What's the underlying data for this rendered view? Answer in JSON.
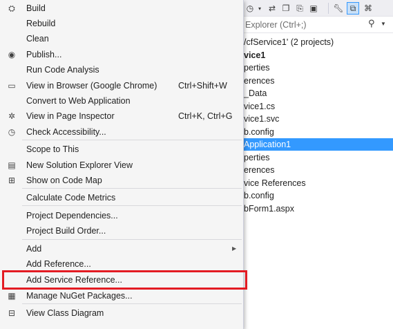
{
  "menu": {
    "items": [
      {
        "label": "Build",
        "icon": "build-icon",
        "glyph": "⛭"
      },
      {
        "label": "Rebuild",
        "icon": "",
        "glyph": ""
      },
      {
        "label": "Clean",
        "icon": "",
        "glyph": ""
      },
      {
        "label": "Publish...",
        "icon": "publish-globe-icon",
        "glyph": "◉"
      },
      {
        "label": "Run Code Analysis",
        "icon": "",
        "glyph": ""
      },
      {
        "label": "View in Browser (Google Chrome)",
        "shortcut": "Ctrl+Shift+W",
        "icon": "browser-window-icon",
        "glyph": "▭"
      },
      {
        "label": "Convert to Web Application",
        "icon": "",
        "glyph": ""
      },
      {
        "label": "View in Page Inspector",
        "shortcut": "Ctrl+K, Ctrl+G",
        "icon": "page-inspector-icon",
        "glyph": "✲"
      },
      {
        "label": "Check Accessibility...",
        "icon": "accessibility-clock-icon",
        "glyph": "◷"
      },
      {
        "label": "Scope to This",
        "icon": "",
        "glyph": ""
      },
      {
        "label": "New Solution Explorer View",
        "icon": "new-explorer-view-icon",
        "glyph": "▤"
      },
      {
        "label": "Show on Code Map",
        "icon": "code-map-icon",
        "glyph": "⊞"
      },
      {
        "label": "Calculate Code Metrics",
        "icon": "",
        "glyph": ""
      },
      {
        "label": "Project Dependencies...",
        "icon": "",
        "glyph": ""
      },
      {
        "label": "Project Build Order...",
        "icon": "",
        "glyph": ""
      },
      {
        "label": "Add",
        "icon": "",
        "glyph": "",
        "submenu_arrow": "▶"
      },
      {
        "label": "Add Reference...",
        "icon": "",
        "glyph": ""
      },
      {
        "label": "Add Service Reference...",
        "icon": "",
        "glyph": ""
      },
      {
        "label": "Manage NuGet Packages...",
        "icon": "nuget-package-icon",
        "glyph": "▦"
      },
      {
        "label": "View Class Diagram",
        "icon": "class-diagram-icon",
        "glyph": "⊟"
      }
    ]
  },
  "solution_explorer": {
    "search_placeholder": "Explorer (Ctrl+;)",
    "search_icon": "search-icon",
    "tree": [
      {
        "label": "/cfService1' (2 projects)"
      },
      {
        "label": "vice1",
        "bold": true
      },
      {
        "label": "perties"
      },
      {
        "label": "erences"
      },
      {
        "label": "_Data"
      },
      {
        "label": "vice1.cs"
      },
      {
        "label": "vice1.svc"
      },
      {
        "label": "b.config"
      },
      {
        "label": "Application1",
        "selected": true
      },
      {
        "label": "perties"
      },
      {
        "label": "erences"
      },
      {
        "label": "vice References"
      },
      {
        "label": "b.config"
      },
      {
        "label": "bForm1.aspx"
      }
    ]
  },
  "colors": {
    "highlight_border": "#e31b23",
    "selection": "#3399ff"
  }
}
